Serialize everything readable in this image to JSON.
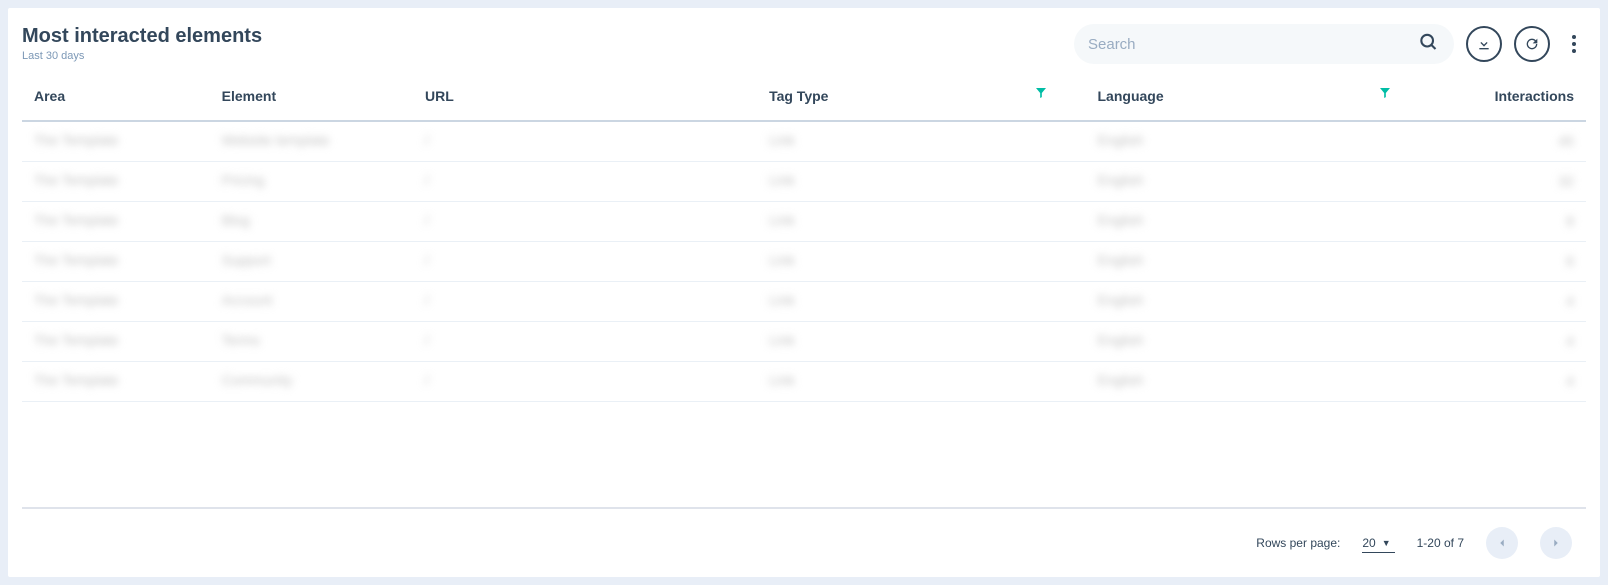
{
  "header": {
    "title": "Most interacted elements",
    "subtitle": "Last 30 days",
    "search_placeholder": "Search"
  },
  "columns": {
    "area": "Area",
    "element": "Element",
    "url": "URL",
    "tag_type": "Tag Type",
    "language": "Language",
    "interactions": "Interactions"
  },
  "rows": [
    {
      "area": "The Template",
      "element": "Website template",
      "url": "/",
      "tag": "Link",
      "lang": "English",
      "inter": "45"
    },
    {
      "area": "The Template",
      "element": "Pricing",
      "url": "/",
      "tag": "Link",
      "lang": "English",
      "inter": "32"
    },
    {
      "area": "The Template",
      "element": "Blog",
      "url": "/",
      "tag": "Link",
      "lang": "English",
      "inter": "8"
    },
    {
      "area": "The Template",
      "element": "Support",
      "url": "/",
      "tag": "Link",
      "lang": "English",
      "inter": "6"
    },
    {
      "area": "The Template",
      "element": "Account",
      "url": "/",
      "tag": "Link",
      "lang": "English",
      "inter": "4"
    },
    {
      "area": "The Template",
      "element": "Terms",
      "url": "/",
      "tag": "Link",
      "lang": "English",
      "inter": "4"
    },
    {
      "area": "The Template",
      "element": "Community",
      "url": "/",
      "tag": "Link",
      "lang": "English",
      "inter": "4"
    }
  ],
  "footer": {
    "rows_per_page_label": "Rows per page:",
    "rows_per_page_value": "20",
    "page_info": "1-20 of 7"
  }
}
